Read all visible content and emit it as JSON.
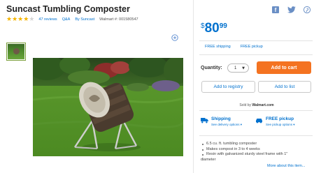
{
  "product": {
    "title": "Suncast Tumbling Composter",
    "rating": 4,
    "rating_max": 5,
    "reviews": "47 reviews",
    "qa": "Q&A",
    "brand": "By Suncast",
    "item_number": "Walmart #: 001580547"
  },
  "price": {
    "dollar_sign": "$",
    "main": "80",
    "cents": "99"
  },
  "shipping_links": {
    "free_shipping": "FREE shipping",
    "free_pickup": "FREE pickup"
  },
  "purchase": {
    "quantity_label": "Quantity:",
    "quantity_value": "1",
    "add_to_cart": "Add to cart",
    "add_to_registry": "Add to registry",
    "add_to_list": "Add to list"
  },
  "seller": {
    "prefix": "Sold by",
    "name": "Walmart.com"
  },
  "fulfillment": {
    "shipping_title": "Shipping",
    "shipping_link": "See delivery options",
    "pickup_title": "FREE pickup",
    "pickup_link": "See pickup options"
  },
  "features": [
    "6.5 cu. ft. tumbling composter",
    "Makes compost in 3 to 4 weeks",
    "Resin with galvanized sturdy steel frame with 1\"",
    "diameter"
  ],
  "more_link": "More about this item...",
  "icons": {
    "facebook": "facebook-icon",
    "twitter": "twitter-icon",
    "pinterest": "pinterest-icon",
    "zoom": "zoom-in-icon",
    "truck": "truck-icon",
    "car": "car-icon"
  },
  "colors": {
    "brand_blue": "#0071ce",
    "cart_orange": "#f47321",
    "star_gold": "#f4b400"
  }
}
